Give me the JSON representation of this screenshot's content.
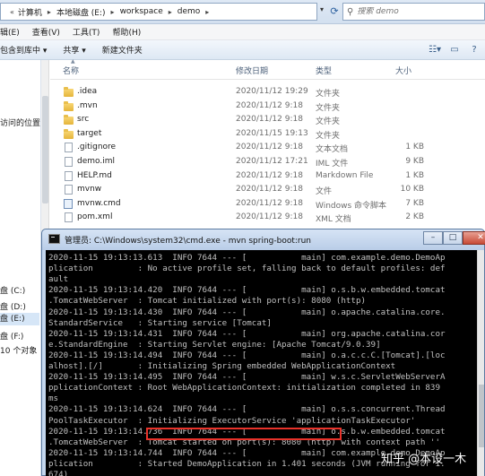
{
  "explorer": {
    "address": {
      "crumbs": [
        "计算机",
        "本地磁盘 (E:)",
        "workspace",
        "demo"
      ],
      "separator": "▸",
      "nav_arrow": "«"
    },
    "search": {
      "placeholder": "搜索 demo"
    },
    "menu": [
      "辑(E)",
      "查看(V)",
      "工具(T)",
      "帮助(H)"
    ],
    "toolbar": {
      "include_library": "包含到库中 ▾",
      "share": "共享 ▾",
      "new_folder": "新建文件夹"
    },
    "nav_pane": {
      "items": [
        {
          "label": "访问的位置",
          "selected": false
        },
        {
          "label": "盘 (C:)",
          "selected": false
        },
        {
          "label": "盘 (D:)",
          "selected": false
        },
        {
          "label": "盘 (E:)",
          "selected": true
        },
        {
          "label": "盘 (F:)",
          "selected": false
        },
        {
          "label": "10 个对象",
          "selected": false
        }
      ]
    },
    "columns": {
      "name": "名称",
      "date": "修改日期",
      "type": "类型",
      "size": "大小"
    },
    "files": [
      {
        "name": ".idea",
        "date": "2020/11/12 19:29",
        "type": "文件夹",
        "size": "",
        "icon": "folder"
      },
      {
        "name": ".mvn",
        "date": "2020/11/12 9:18",
        "type": "文件夹",
        "size": "",
        "icon": "folder"
      },
      {
        "name": "src",
        "date": "2020/11/12 9:18",
        "type": "文件夹",
        "size": "",
        "icon": "folder"
      },
      {
        "name": "target",
        "date": "2020/11/15 19:13",
        "type": "文件夹",
        "size": "",
        "icon": "folder"
      },
      {
        "name": ".gitignore",
        "date": "2020/11/12 9:18",
        "type": "文本文档",
        "size": "1 KB",
        "icon": "document"
      },
      {
        "name": "demo.iml",
        "date": "2020/11/12 17:21",
        "type": "IML 文件",
        "size": "9 KB",
        "icon": "document"
      },
      {
        "name": "HELP.md",
        "date": "2020/11/12 9:18",
        "type": "Markdown File",
        "size": "1 KB",
        "icon": "document"
      },
      {
        "name": "mvnw",
        "date": "2020/11/12 9:18",
        "type": "文件",
        "size": "10 KB",
        "icon": "document"
      },
      {
        "name": "mvnw.cmd",
        "date": "2020/11/12 9:18",
        "type": "Windows 命令脚本",
        "size": "7 KB",
        "icon": "script"
      },
      {
        "name": "pom.xml",
        "date": "2020/11/12 9:18",
        "type": "XML 文档",
        "size": "2 KB",
        "icon": "document"
      }
    ]
  },
  "console": {
    "title": "管理员: C:\\Windows\\system32\\cmd.exe - mvn  spring-boot:run",
    "buttons": {
      "minimize": "–",
      "maximize": "□",
      "close": "✕"
    },
    "lines": [
      "2020-11-15 19:13:13.613  INFO 7644 --- [           main] com.example.demo.DemoAp",
      "plication         : No active profile set, falling back to default profiles: def",
      "ault",
      "2020-11-15 19:13:14.420  INFO 7644 --- [           main] o.s.b.w.embedded.tomcat",
      ".TomcatWebServer  : Tomcat initialized with port(s): 8080 (http)",
      "2020-11-15 19:13:14.430  INFO 7644 --- [           main] o.apache.catalina.core.",
      "StandardService   : Starting service [Tomcat]",
      "2020-11-15 19:13:14.431  INFO 7644 --- [           main] org.apache.catalina.cor",
      "e.StandardEngine  : Starting Servlet engine: [Apache Tomcat/9.0.39]",
      "2020-11-15 19:13:14.494  INFO 7644 --- [           main] o.a.c.c.C.[Tomcat].[loc",
      "alhost].[/]       : Initializing Spring embedded WebApplicationContext",
      "2020-11-15 19:13:14.495  INFO 7644 --- [           main] w.s.c.ServletWebServerA",
      "pplicationContext : Root WebApplicationContext: initialization completed in 839",
      "ms",
      "2020-11-15 19:13:14.624  INFO 7644 --- [           main] o.s.s.concurrent.Thread",
      "PoolTaskExecutor  : Initializing ExecutorService 'applicationTaskExecutor'",
      "2020-11-15 19:13:14.736  INFO 7644 --- [           main] o.s.b.w.embedded.tomcat",
      ".TomcatWebServer  : Tomcat started on port(s): 8080 (http) with context path ''",
      "2020-11-15 19:13:14.744  INFO 7644 --- [           main] com.example.demo.DemoAp",
      "plication         : Started DemoApplication in 1.401 seconds (JVM running for 1.",
      "674)"
    ]
  },
  "watermark": "知乎 @本设一木"
}
